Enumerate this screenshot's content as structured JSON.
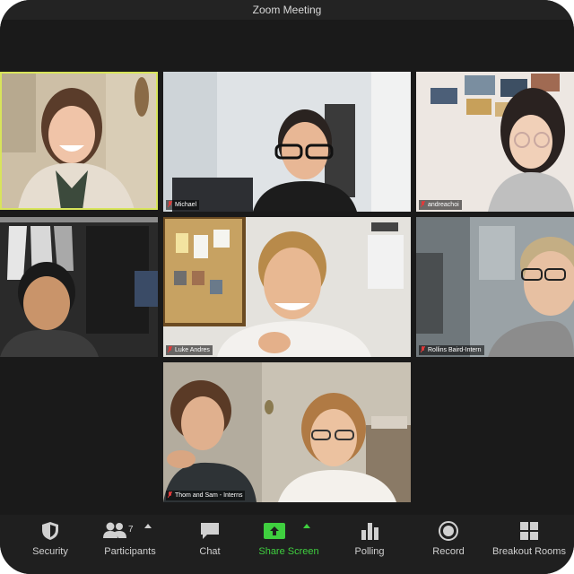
{
  "window": {
    "title": "Zoom Meeting"
  },
  "participants": [
    {
      "name": ""
    },
    {
      "name": "Michael"
    },
    {
      "name": "andreachoi"
    },
    {
      "name": ""
    },
    {
      "name": "Luke Andres"
    },
    {
      "name": "Rollins Baird-Intern"
    },
    {
      "name": "Thom and Sam - Interns"
    }
  ],
  "toolbar": {
    "security": {
      "label": "Security",
      "icon": "shield-icon"
    },
    "participants": {
      "label": "Participants",
      "count": "7",
      "icon": "people-icon"
    },
    "chat": {
      "label": "Chat",
      "icon": "chat-bubble-icon"
    },
    "share": {
      "label": "Share Screen",
      "icon": "share-screen-icon",
      "color": "#3fcf3f"
    },
    "polling": {
      "label": "Polling",
      "icon": "bar-chart-icon"
    },
    "record": {
      "label": "Record",
      "icon": "record-icon"
    },
    "breakout": {
      "label": "Breakout Rooms",
      "icon": "grid-icon"
    }
  },
  "colors": {
    "active_speaker": "#d8e45b",
    "share_green": "#3fcf3f",
    "mic_red": "#e03a3a"
  }
}
